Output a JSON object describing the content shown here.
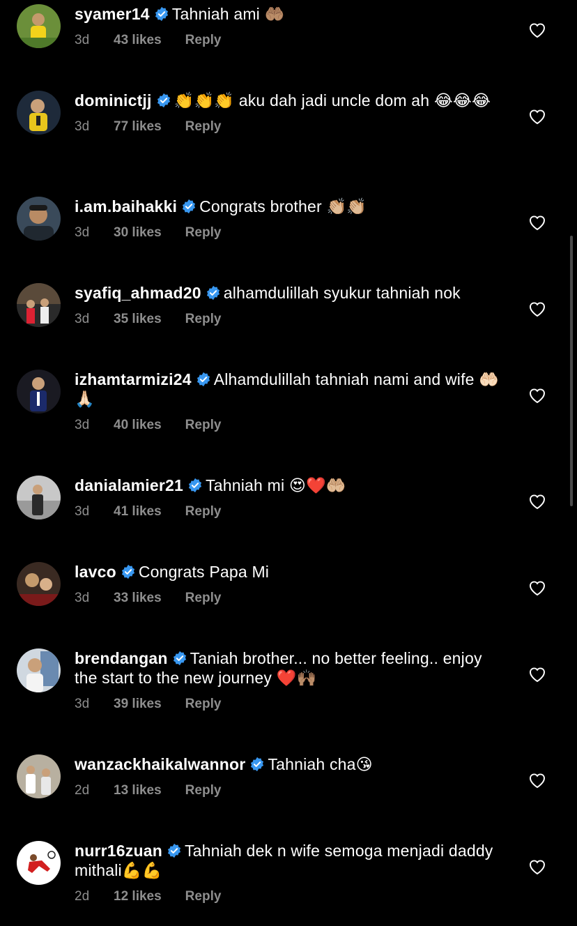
{
  "accent_colors": {
    "background": "#000000",
    "text": "#ffffff",
    "meta": "#8e8e8e",
    "verified": "#3897f0",
    "heart_outline": "#ffffff"
  },
  "reply_label": "Reply",
  "comments": [
    {
      "username": "syamer14",
      "text": "Tahniah ami 🤲🏽",
      "age": "3d",
      "likes": "43 likes"
    },
    {
      "username": "dominictjj",
      "text": "👏👏👏 aku dah jadi uncle dom ah 😂😂😂",
      "age": "3d",
      "likes": "77 likes"
    },
    {
      "username": "i.am.baihakki",
      "text": "Congrats brother 👏🏼👏🏼",
      "age": "3d",
      "likes": "30 likes"
    },
    {
      "username": "syafiq_ahmad20",
      "text": "alhamdulillah syukur tahniah nok",
      "age": "3d",
      "likes": "35 likes"
    },
    {
      "username": "izhamtarmizi24",
      "text": "Alhamdulillah tahniah nami and wife 🤲🏻🙏🏻",
      "age": "3d",
      "likes": "40 likes"
    },
    {
      "username": "danialamier21",
      "text": "Tahniah mi 😍❤️🤲🏼",
      "age": "3d",
      "likes": "41 likes"
    },
    {
      "username": "lavco",
      "text": "Congrats Papa Mi",
      "age": "3d",
      "likes": "33 likes"
    },
    {
      "username": "brendangan",
      "text": "Taniah brother... no better feeling.. enjoy the start to the new journey ❤️🙌🏽",
      "age": "3d",
      "likes": "39 likes"
    },
    {
      "username": "wanzackhaikalwannor",
      "text": "Tahniah cha😘",
      "age": "2d",
      "likes": "13 likes"
    },
    {
      "username": "nurr16zuan",
      "text": "Tahniah dek n wife semoga menjadi daddy mithali💪💪",
      "age": "2d",
      "likes": "12 likes"
    }
  ]
}
